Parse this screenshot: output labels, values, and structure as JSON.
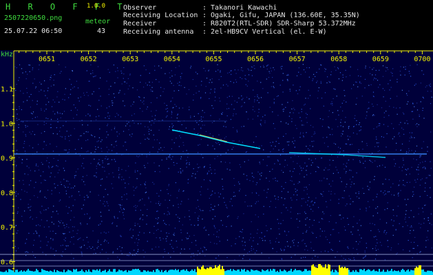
{
  "app": {
    "name": "H R O F F T",
    "version": "1.0.0",
    "filename": "2507220650.png",
    "datetime": "25.07.22 06:50",
    "meteor_label": "meteor",
    "meteor_count": "43"
  },
  "info": {
    "rows": [
      {
        "key": "Observer",
        "value": ": Takanori Kawachi"
      },
      {
        "key": "Receiving Location",
        "value": ": Ogaki, Gifu, JAPAN (136.60E, 35.35N)"
      },
      {
        "key": "Receiver",
        "value": ": R820T2(RTL-SDR) SDR-Sharp 53.372MHz"
      },
      {
        "key": "Receiving antenna",
        "value": ": 2el-HB9CV Vertical (el. E-W)"
      }
    ]
  },
  "axes": {
    "y_unit": "kHz",
    "y_ticks": [
      "1.1",
      "1.0",
      "0.9",
      "0.8",
      "0.7",
      "0.6"
    ],
    "x_ticks": [
      "0651",
      "0652",
      "0653",
      "0654",
      "0655",
      "0656",
      "0657",
      "0658",
      "0659",
      "0700"
    ]
  },
  "colors": {
    "background": "#000000",
    "plot_bg": "#00003a",
    "header_green": "#3fdc3f",
    "header_white": "#e8e8e8",
    "tick_yellow": "#f6f600",
    "trace_cyan": "#00e0ff",
    "activity_yellow": "#ffff00"
  },
  "chart_data": {
    "type": "heatmap",
    "x_range": [
      "06:50",
      "07:00"
    ],
    "y_range_khz": [
      0.57,
      1.18
    ],
    "carrier_khz": 0.91,
    "meteor_trace": {
      "start_time": "06:54.4",
      "end_time": "06:55.9",
      "start_khz": 0.98,
      "end_khz": 0.93
    }
  }
}
